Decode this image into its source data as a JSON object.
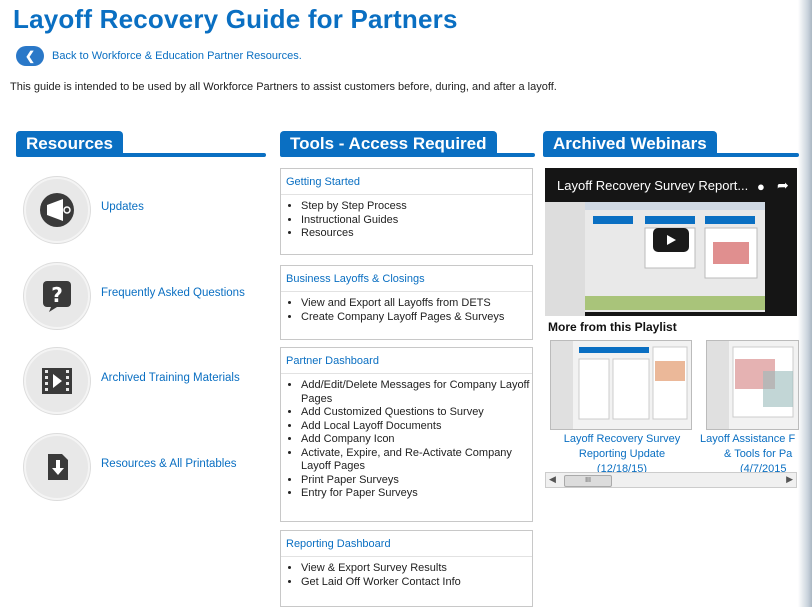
{
  "page": {
    "title": "Layoff Recovery Guide for Partners",
    "back_link": "Back to Workforce & Education Partner Resources.",
    "intro": "This guide is intended to be used by all Workforce Partners to assist customers before, during, and after a layoff."
  },
  "columns": {
    "resources": "Resources",
    "tools": "Tools - Access Required",
    "webinars": "Archived Webinars"
  },
  "resources": [
    {
      "label": "Updates",
      "icon": "megaphone-icon"
    },
    {
      "label": "Frequently Asked Questions",
      "icon": "question-icon"
    },
    {
      "label": "Archived Training Materials",
      "icon": "video-icon"
    },
    {
      "label": "Resources & All Printables",
      "icon": "download-icon"
    }
  ],
  "tools": [
    {
      "title": "Getting Started",
      "items": [
        "Step by Step Process",
        "Instructional Guides",
        "Resources"
      ]
    },
    {
      "title": "Business Layoffs & Closings",
      "items": [
        "View and Export all Layoffs from DETS",
        "Create Company Layoff Pages & Surveys"
      ]
    },
    {
      "title": "Partner Dashboard",
      "items": [
        "Add/Edit/Delete Messages for Company Layoff Pages",
        "Add Customized Questions to Survey",
        "Add Local Layoff Documents",
        "Add Company Icon",
        "Activate, Expire, and Re-Activate Company Layoff Pages",
        "Print Paper Surveys",
        "Entry for Paper Surveys"
      ]
    },
    {
      "title": "Reporting Dashboard",
      "items": [
        "View & Export Survey Results",
        "Get Laid Off Worker Contact Info"
      ]
    }
  ],
  "webinars": {
    "video_title": "Layoff Recovery Survey Report...",
    "more_heading": "More from this Playlist",
    "playlist": [
      {
        "line1": "Layoff Recovery Survey",
        "line2": "Reporting Update",
        "line3": "(12/18/15)"
      },
      {
        "line1": "Layoff Assistance F",
        "line2": "& Tools for Pa",
        "line3": "(4/7/2015"
      }
    ],
    "scroll_grip": "III"
  },
  "colors": {
    "accent": "#0a6fc2",
    "text": "#222222"
  }
}
